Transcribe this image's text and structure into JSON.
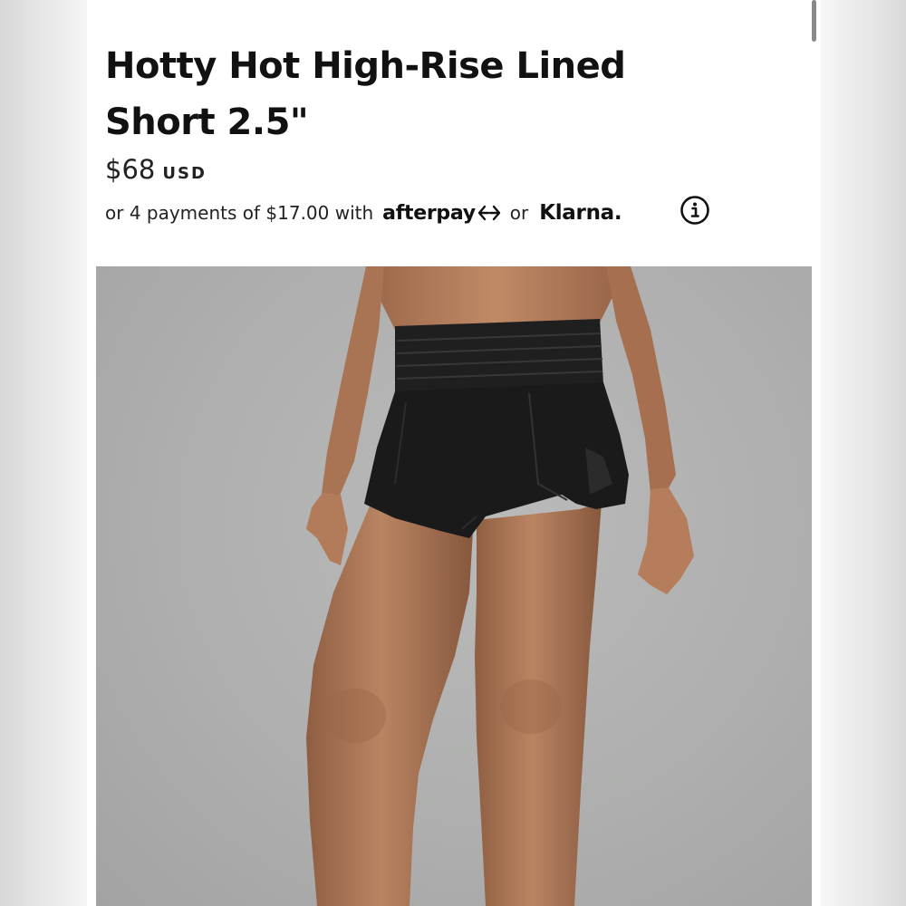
{
  "product": {
    "title": "Hotty Hot High-Rise Lined Short 2.5\"",
    "price": "$68",
    "currency": "USD"
  },
  "payments": {
    "prefix": "or 4 payments of $17.00 with",
    "afterpay_label": "afterpay",
    "or_label": "or",
    "klarna_label": "Klarna."
  },
  "icons": {
    "info": "info-circle-icon",
    "afterpay_logo": "afterpay-arrows-icon"
  },
  "colors": {
    "text": "#111111",
    "photo_background": "#aeafae",
    "shorts": "#1a1a1a",
    "skin": "#b8805c"
  }
}
